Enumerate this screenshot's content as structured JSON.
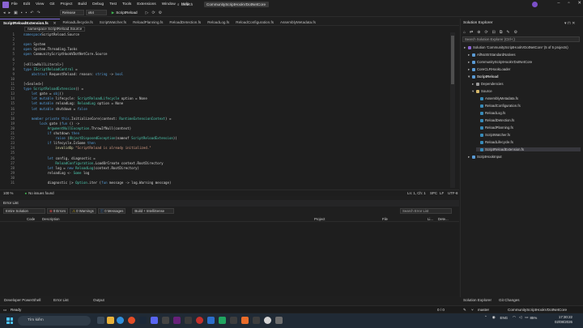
{
  "menu": [
    "File",
    "Edit",
    "View",
    "Git",
    "Project",
    "Build",
    "Debug",
    "Test",
    "Tools",
    "Extensions",
    "Window",
    "Help"
  ],
  "search_label": "Search",
  "solution_title": "CommunityScriptHookVDotNetCore",
  "toolbar": {
    "config": "Release",
    "platform": "x64",
    "run_label": "ScriptReload"
  },
  "tabs": [
    {
      "label": "ScriptReloadExtension.fs",
      "active": true
    },
    {
      "label": "ReloadLifecycle.fs",
      "active": false
    },
    {
      "label": "ScriptWatcher.fs",
      "active": false
    },
    {
      "label": "ReloadPlanning.fs",
      "active": false
    },
    {
      "label": "ReloadDetection.fs",
      "active": false
    },
    {
      "label": "ReloadLog.fs",
      "active": false
    },
    {
      "label": "ReloadConfiguration.fs",
      "active": false
    },
    {
      "label": "AssemblyMetadata.fs",
      "active": false
    }
  ],
  "editor": {
    "namespace_dropdown": "namespace ScriptReload.Source",
    "zoom": "100 %",
    "issues": "No issues found",
    "position": "Ln: 1, Ch: 1",
    "spc": "SPC",
    "lf": "LF",
    "encoding": "UTF-8"
  },
  "code_lines": [
    {
      "n": "1",
      "segs": [
        [
          "kw",
          "namespace"
        ],
        [
          "",
          "ScriptReload.Source"
        ]
      ]
    },
    {
      "n": "2",
      "segs": []
    },
    {
      "n": "3",
      "segs": [
        [
          "kw",
          "open "
        ],
        [
          "",
          "System"
        ]
      ]
    },
    {
      "n": "4",
      "segs": [
        [
          "kw",
          "open "
        ],
        [
          "",
          "System.Threading.Tasks"
        ]
      ]
    },
    {
      "n": "5",
      "segs": [
        [
          "kw",
          "open "
        ],
        [
          "",
          "CommunityScriptHookVDotNetCore.Source"
        ]
      ]
    },
    {
      "n": "6",
      "segs": []
    },
    {
      "n": "7",
      "segs": [
        [
          "at",
          "[<AllowNullLiteral>]"
        ]
      ]
    },
    {
      "n": "8",
      "segs": [
        [
          "kw",
          "type "
        ],
        [
          "ty",
          "IScriptReloadControl"
        ],
        [
          "",
          " ="
        ]
      ]
    },
    {
      "n": "9",
      "segs": [
        [
          "kw",
          "    abstract "
        ],
        [
          "",
          "RequestReload: reason: "
        ],
        [
          "kw",
          "string"
        ],
        [
          "",
          " -> "
        ],
        [
          "kw",
          "bool"
        ]
      ]
    },
    {
      "n": "10",
      "segs": []
    },
    {
      "n": "11",
      "segs": [
        [
          "at",
          "[<Sealed>]"
        ]
      ]
    },
    {
      "n": "12",
      "segs": [
        [
          "kw",
          "type "
        ],
        [
          "ty",
          "ScriptReloadExtension"
        ],
        [
          "",
          "() ="
        ]
      ]
    },
    {
      "n": "13",
      "segs": [
        [
          "kw",
          "    let "
        ],
        [
          "",
          "gate = "
        ],
        [
          "kw",
          "obj"
        ],
        [
          "",
          "()"
        ]
      ]
    },
    {
      "n": "14",
      "segs": [
        [
          "kw",
          "    let mutable "
        ],
        [
          "",
          "lifecycle: "
        ],
        [
          "ty",
          "ScriptReloadLifecycle"
        ],
        [
          "",
          " option = None"
        ]
      ]
    },
    {
      "n": "15",
      "segs": [
        [
          "kw",
          "    let mutable "
        ],
        [
          "",
          "reloadLog: "
        ],
        [
          "ty",
          "ReloadLog"
        ],
        [
          "",
          " option = None"
        ]
      ]
    },
    {
      "n": "16",
      "segs": [
        [
          "kw",
          "    let mutable "
        ],
        [
          "",
          "shutdown = "
        ],
        [
          "kw",
          "false"
        ]
      ]
    },
    {
      "n": "17",
      "segs": []
    },
    {
      "n": "18",
      "segs": [
        [
          "kw",
          "    member private "
        ],
        [
          "kw",
          "this"
        ],
        [
          "",
          ".InitializeCore(context: "
        ],
        [
          "ty",
          "RuntimeExtensionContext"
        ],
        [
          "",
          ") ="
        ]
      ]
    },
    {
      "n": "19",
      "segs": [
        [
          "kw",
          "        lock "
        ],
        [
          "",
          "gate ("
        ],
        [
          "kw",
          "fun"
        ],
        [
          "",
          " () ->"
        ]
      ]
    },
    {
      "n": "20",
      "segs": [
        [
          "ty",
          "            ArgumentNullException"
        ],
        [
          "",
          ".ThrowIfNull(context)"
        ]
      ]
    },
    {
      "n": "21",
      "segs": [
        [
          "kw",
          "            if "
        ],
        [
          "",
          "shutdown "
        ],
        [
          "kw",
          "then"
        ]
      ]
    },
    {
      "n": "22",
      "segs": [
        [
          "kw",
          "                raise "
        ],
        [
          "",
          "("
        ],
        [
          "ty",
          "ObjectDisposedException"
        ],
        [
          "",
          "(nameof "
        ],
        [
          "ty",
          "ScriptReloadExtension"
        ],
        [
          "",
          "))"
        ]
      ]
    },
    {
      "n": "23",
      "segs": [
        [
          "kw",
          "            if "
        ],
        [
          "",
          "lifecycle.IsSome "
        ],
        [
          "kw",
          "then"
        ]
      ]
    },
    {
      "n": "24",
      "segs": [
        [
          "fn",
          "                invalidOp "
        ],
        [
          "str",
          "\"ScriptReload is already initialized.\""
        ]
      ]
    },
    {
      "n": "25",
      "segs": []
    },
    {
      "n": "26",
      "segs": [
        [
          "kw",
          "            let "
        ],
        [
          "",
          "config, diagnostic ="
        ]
      ]
    },
    {
      "n": "27",
      "segs": [
        [
          "ty",
          "                ReloadConfiguration"
        ],
        [
          "",
          ".LoadOrCreate context.RootDirectory"
        ]
      ]
    },
    {
      "n": "28",
      "segs": [
        [
          "kw",
          "            let "
        ],
        [
          "",
          "log = "
        ],
        [
          "kw",
          "new "
        ],
        [
          "ty",
          "ReloadLog"
        ],
        [
          "",
          "(context.RootDirectory)"
        ]
      ]
    },
    {
      "n": "29",
      "segs": [
        [
          "",
          "            reloadLog <- "
        ],
        [
          "ty",
          "Some"
        ],
        [
          "",
          " log"
        ]
      ]
    },
    {
      "n": "30",
      "segs": []
    },
    {
      "n": "31",
      "segs": [
        [
          "",
          "            diagnostic |> "
        ],
        [
          "ty",
          "Option"
        ],
        [
          "",
          ".iter ("
        ],
        [
          "kw",
          "fun"
        ],
        [
          "",
          " message -> log.Warning message)"
        ]
      ]
    }
  ],
  "error_list": {
    "title": "Error List",
    "scope": "Entire Solution",
    "errors": "0 Errors",
    "warnings": "0 Warnings",
    "messages": "0 Messages",
    "build_filter": "Build + IntelliSense",
    "search_placeholder": "Search Error List",
    "columns": [
      "Code",
      "Description",
      "Project",
      "File",
      "Li...",
      "Dete..."
    ]
  },
  "bottom_tabs": [
    "Developer PowerShell",
    "Error List",
    "Output"
  ],
  "solution_explorer": {
    "title": "Solution Explorer",
    "search_placeholder": "Search Solution Explorer (Ctrl+;)",
    "items": [
      {
        "label": "Solution 'CommunityScriptHookVDotNetCore' (5 of 5 projects)",
        "indent": 0,
        "kind": "solution"
      },
      {
        "label": "AllNoStrStandardNatives",
        "indent": 1,
        "kind": "project"
      },
      {
        "label": "CommunityScriptHookVDotNetCore",
        "indent": 1,
        "kind": "project"
      },
      {
        "label": "CoreCLRHookLoader",
        "indent": 1,
        "kind": "project"
      },
      {
        "label": "ScriptReload",
        "indent": 1,
        "kind": "project-bold"
      },
      {
        "label": "Dependencies",
        "indent": 2,
        "kind": "deps"
      },
      {
        "label": "Source",
        "indent": 2,
        "kind": "folder"
      },
      {
        "label": "AssemblyMetadata.fs",
        "indent": 3,
        "kind": "fs"
      },
      {
        "label": "ReloadConfiguration.fs",
        "indent": 3,
        "kind": "fs"
      },
      {
        "label": "ReloadLog.fs",
        "indent": 3,
        "kind": "fs"
      },
      {
        "label": "ReloadDetection.fs",
        "indent": 3,
        "kind": "fs"
      },
      {
        "label": "ReloadPlanning.fs",
        "indent": 3,
        "kind": "fs"
      },
      {
        "label": "ScriptWatcher.fs",
        "indent": 3,
        "kind": "fs"
      },
      {
        "label": "ReloadLifecycle.fs",
        "indent": 3,
        "kind": "fs"
      },
      {
        "label": "ScriptReloadExtension.fs",
        "indent": 3,
        "kind": "fs-selected"
      },
      {
        "label": "ScriptHookInput",
        "indent": 1,
        "kind": "project"
      }
    ],
    "bottom_tabs": [
      "Solution Explorer",
      "Git Changes"
    ]
  },
  "status_bar": {
    "ready": "Ready",
    "counts": "0 / 0",
    "branch": "master",
    "repo": "CommunityScriptHookVDotNetCore"
  },
  "taskbar": {
    "search_placeholder": "Tìm kiếm",
    "lang": "ENG",
    "battery": "85%",
    "time": "17:30:22",
    "date": "02/08/2026"
  },
  "colors": {
    "accent": "#7c6ad6",
    "keyword": "#569cd6",
    "type": "#4ec9b0",
    "string": "#d69d85",
    "ok": "#3fb950"
  }
}
